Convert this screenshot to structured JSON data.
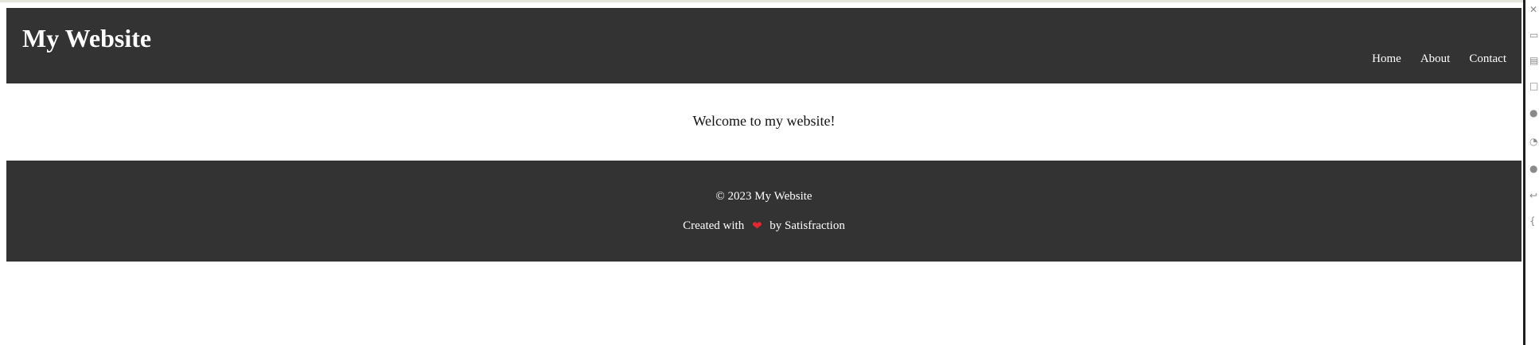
{
  "header": {
    "title": "My Website",
    "nav": [
      {
        "label": "Home"
      },
      {
        "label": "About"
      },
      {
        "label": "Contact"
      }
    ]
  },
  "main": {
    "welcome": "Welcome to my website!"
  },
  "footer": {
    "copyright": "© 2023 My Website",
    "credit_prefix": "Created with",
    "credit_icon": "heart-icon",
    "credit_suffix": "by Satisfraction"
  },
  "colors": {
    "bar": "#333333",
    "text_light": "#ffffff",
    "heart": "#e8262f"
  },
  "right_rail": {
    "icons": [
      "tool-icon",
      "tool-icon",
      "tool-icon",
      "tool-icon",
      "tool-icon",
      "tool-icon",
      "tool-icon",
      "tool-icon",
      "tool-icon"
    ]
  }
}
